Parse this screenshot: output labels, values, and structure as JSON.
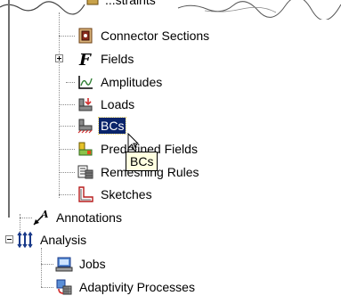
{
  "tree": {
    "top_partial_label": "...straints",
    "items": [
      {
        "label": "Connector Sections",
        "icon": "connector-sections-icon"
      },
      {
        "label": "Fields",
        "icon": "fields-icon"
      },
      {
        "label": "Amplitudes",
        "icon": "amplitudes-icon"
      },
      {
        "label": "Loads",
        "icon": "loads-icon"
      },
      {
        "label": "BCs",
        "icon": "bcs-icon",
        "selected": true
      },
      {
        "label": "Predefined Fields",
        "icon": "predefined-fields-icon"
      },
      {
        "label": "Remeshing Rules",
        "icon": "remeshing-rules-icon"
      },
      {
        "label": "Sketches",
        "icon": "sketches-icon"
      },
      {
        "label": "Annotations",
        "icon": "annotations-icon"
      },
      {
        "label": "Analysis",
        "icon": "analysis-icon"
      },
      {
        "label": "Jobs",
        "icon": "jobs-icon"
      },
      {
        "label": "Adaptivity Processes",
        "icon": "adaptivity-processes-icon"
      }
    ]
  },
  "tooltip": {
    "text": "BCs"
  },
  "colors": {
    "selection_bg": "#0a246a",
    "tooltip_bg": "#ffffe1"
  }
}
